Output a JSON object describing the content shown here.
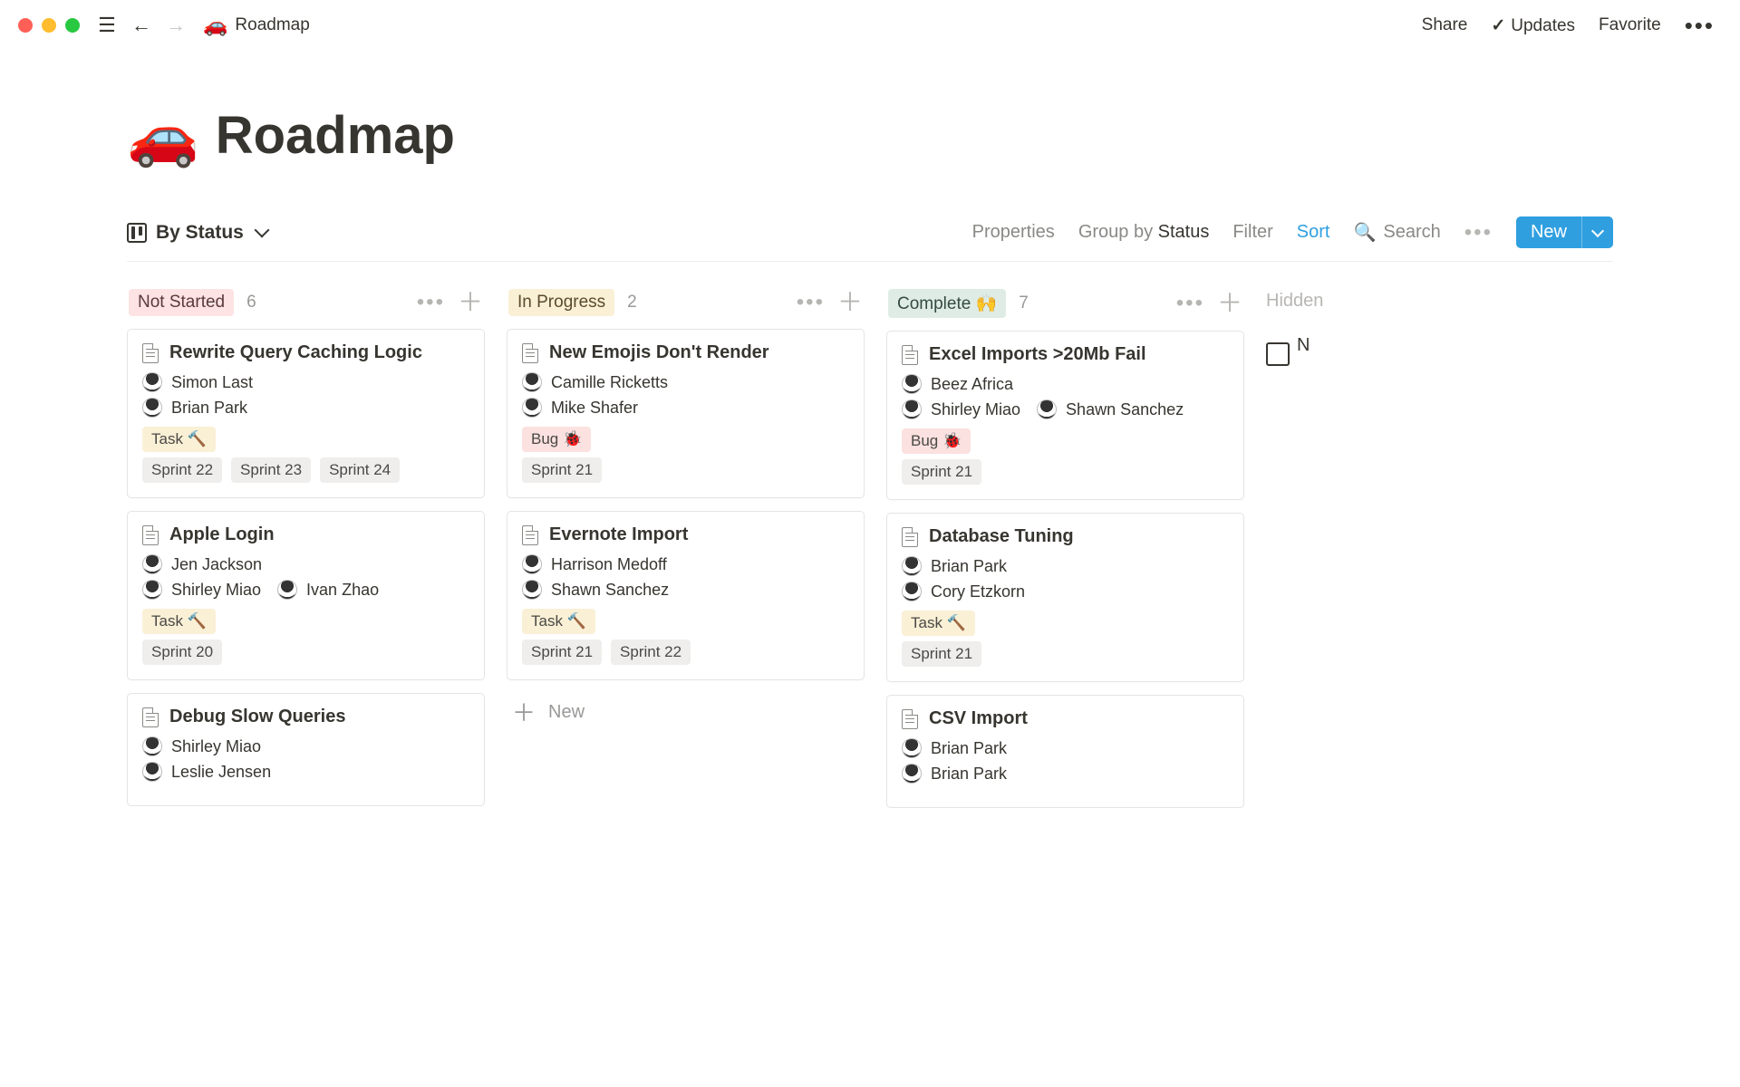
{
  "chrome": {
    "breadcrumb_icon": "🚗",
    "breadcrumb_title": "Roadmap",
    "actions": {
      "share": "Share",
      "updates": "Updates",
      "favorite": "Favorite"
    }
  },
  "page": {
    "icon": "🚗",
    "title": "Roadmap"
  },
  "view_toolbar": {
    "view_name": "By Status",
    "properties": "Properties",
    "group_by_prefix": "Group by ",
    "group_by_value": "Status",
    "filter": "Filter",
    "sort": "Sort",
    "search": "Search",
    "new_label": "New"
  },
  "board": {
    "hidden_label": "Hidden",
    "inbox_letter": "N",
    "add_new_label": "New",
    "columns": [
      {
        "status": "Not Started",
        "count": "6",
        "chip_class": "chip-notstarted",
        "cards": [
          {
            "title": "Rewrite Query Caching Logic",
            "people": [
              [
                "Simon Last"
              ],
              [
                "Brian Park"
              ]
            ],
            "type_tag": {
              "label": "Task 🔨",
              "cls": "tag-task"
            },
            "sprints": [
              "Sprint 22",
              "Sprint 23",
              "Sprint 24"
            ]
          },
          {
            "title": "Apple Login",
            "people": [
              [
                "Jen Jackson"
              ],
              [
                "Shirley Miao",
                "Ivan Zhao"
              ]
            ],
            "type_tag": {
              "label": "Task 🔨",
              "cls": "tag-task"
            },
            "sprints": [
              "Sprint 20"
            ]
          },
          {
            "title": "Debug Slow Queries",
            "people": [
              [
                "Shirley Miao"
              ],
              [
                "Leslie Jensen"
              ]
            ],
            "type_tag": null,
            "sprints": []
          }
        ]
      },
      {
        "status": "In Progress",
        "count": "2",
        "chip_class": "chip-inprogress",
        "cards": [
          {
            "title": "New Emojis Don't Render",
            "people": [
              [
                "Camille Ricketts"
              ],
              [
                "Mike Shafer"
              ]
            ],
            "type_tag": {
              "label": "Bug 🐞",
              "cls": "tag-bug"
            },
            "sprints": [
              "Sprint 21"
            ]
          },
          {
            "title": "Evernote Import",
            "people": [
              [
                "Harrison Medoff"
              ],
              [
                "Shawn Sanchez"
              ]
            ],
            "type_tag": {
              "label": "Task 🔨",
              "cls": "tag-task"
            },
            "sprints": [
              "Sprint 21",
              "Sprint 22"
            ]
          }
        ],
        "show_add_new": true
      },
      {
        "status": "Complete 🙌",
        "count": "7",
        "chip_class": "chip-complete",
        "cards": [
          {
            "title": "Excel Imports >20Mb Fail",
            "people": [
              [
                "Beez Africa"
              ],
              [
                "Shirley Miao",
                "Shawn Sanchez"
              ]
            ],
            "type_tag": {
              "label": "Bug 🐞",
              "cls": "tag-bug"
            },
            "sprints": [
              "Sprint 21"
            ]
          },
          {
            "title": "Database Tuning",
            "people": [
              [
                "Brian Park"
              ],
              [
                "Cory Etzkorn"
              ]
            ],
            "type_tag": {
              "label": "Task 🔨",
              "cls": "tag-task"
            },
            "sprints": [
              "Sprint 21"
            ]
          },
          {
            "title": "CSV Import",
            "people": [
              [
                "Brian Park"
              ],
              [
                "Brian Park"
              ]
            ],
            "type_tag": null,
            "sprints": []
          }
        ]
      }
    ]
  }
}
